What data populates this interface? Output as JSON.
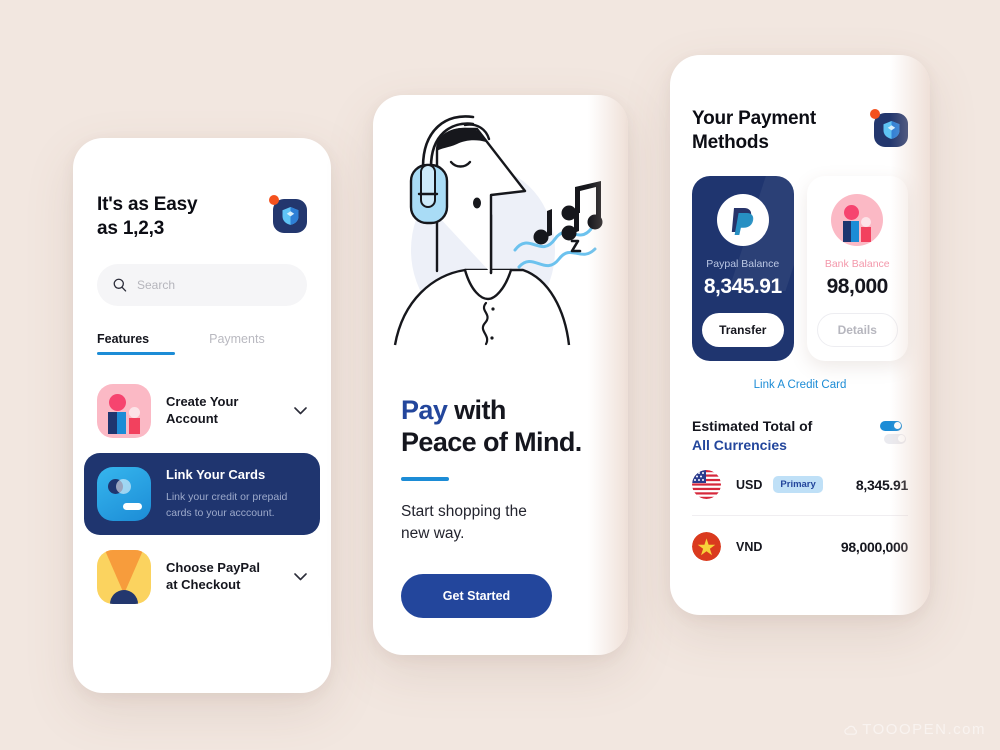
{
  "background_color": "#F2E7E0",
  "watermark": "TOOOPEN.com",
  "brand": {
    "navy": "#1F356F",
    "blue": "#1C8CD6",
    "deep_blue": "#23469C",
    "pink": "#FBB9C5",
    "red": "#F6446F",
    "yellow": "#FBD35F",
    "orange_dot": "#F4511E"
  },
  "screen_features": {
    "logo_icon": "shield-logo-icon",
    "notification_dot": true,
    "title_line1": "It's as Easy",
    "title_line2": "as 1,2,3",
    "search": {
      "icon": "search-icon",
      "placeholder": "Search",
      "value": ""
    },
    "tabs": [
      {
        "label": "Features",
        "active": true
      },
      {
        "label": "Payments",
        "active": false
      }
    ],
    "items": [
      {
        "icon": "people-avatar-icon",
        "title": "Create Your\nAccount",
        "title_l1": "Create Your",
        "title_l2": "Account",
        "subtitle": "",
        "highlighted": false,
        "chevron": "chevron-down-icon"
      },
      {
        "icon": "credit-card-icon",
        "title": "Link Your Cards",
        "title_l1": "Link Your Cards",
        "title_l2": "",
        "subtitle_l1": "Link your credit or prepaid",
        "subtitle_l2": "cards to your acccount.",
        "highlighted": true,
        "chevron": ""
      },
      {
        "icon": "paypal-cone-icon",
        "title": "Choose PayPal\nat Checkout",
        "title_l1": "Choose PayPal",
        "title_l2": "at Checkout",
        "subtitle": "",
        "highlighted": false,
        "chevron": "chevron-down-icon"
      }
    ]
  },
  "screen_onboarding": {
    "illustration": "man-with-headphones-listening-to-music-illustration",
    "headline_l1_accent": "Pay",
    "headline_l1_rest": " with",
    "headline_l2": "Peace of Mind.",
    "sub_l1": "Start shopping the",
    "sub_l2": "new way.",
    "cta_label": "Get Started"
  },
  "screen_payment": {
    "logo_icon": "shield-logo-icon",
    "title_l1": "Your Payment",
    "title_l2": "Methods",
    "balance_cards": [
      {
        "id": "paypal",
        "avatar_icon": "paypal-logo-icon",
        "label": "Paypal Balance",
        "amount": "8,345.91",
        "button": "Transfer",
        "selected": true
      },
      {
        "id": "bank",
        "avatar_icon": "people-avatar-icon",
        "label": "Bank Balance",
        "amount": "98,000",
        "button": "Details",
        "selected": false
      }
    ],
    "link_credit_card": "Link A Credit Card",
    "estimated": {
      "title_l1": "Estimated Total of",
      "title_l2": "All Currencies",
      "toggle_on": true,
      "toggle_off": false
    },
    "currencies": [
      {
        "flag": "us-flag-icon",
        "code": "USD",
        "badge": "Primary",
        "amount": "8,345.91"
      },
      {
        "flag": "vietnam-flag-icon",
        "code": "VND",
        "badge": "",
        "amount": "98,000,000"
      }
    ]
  }
}
